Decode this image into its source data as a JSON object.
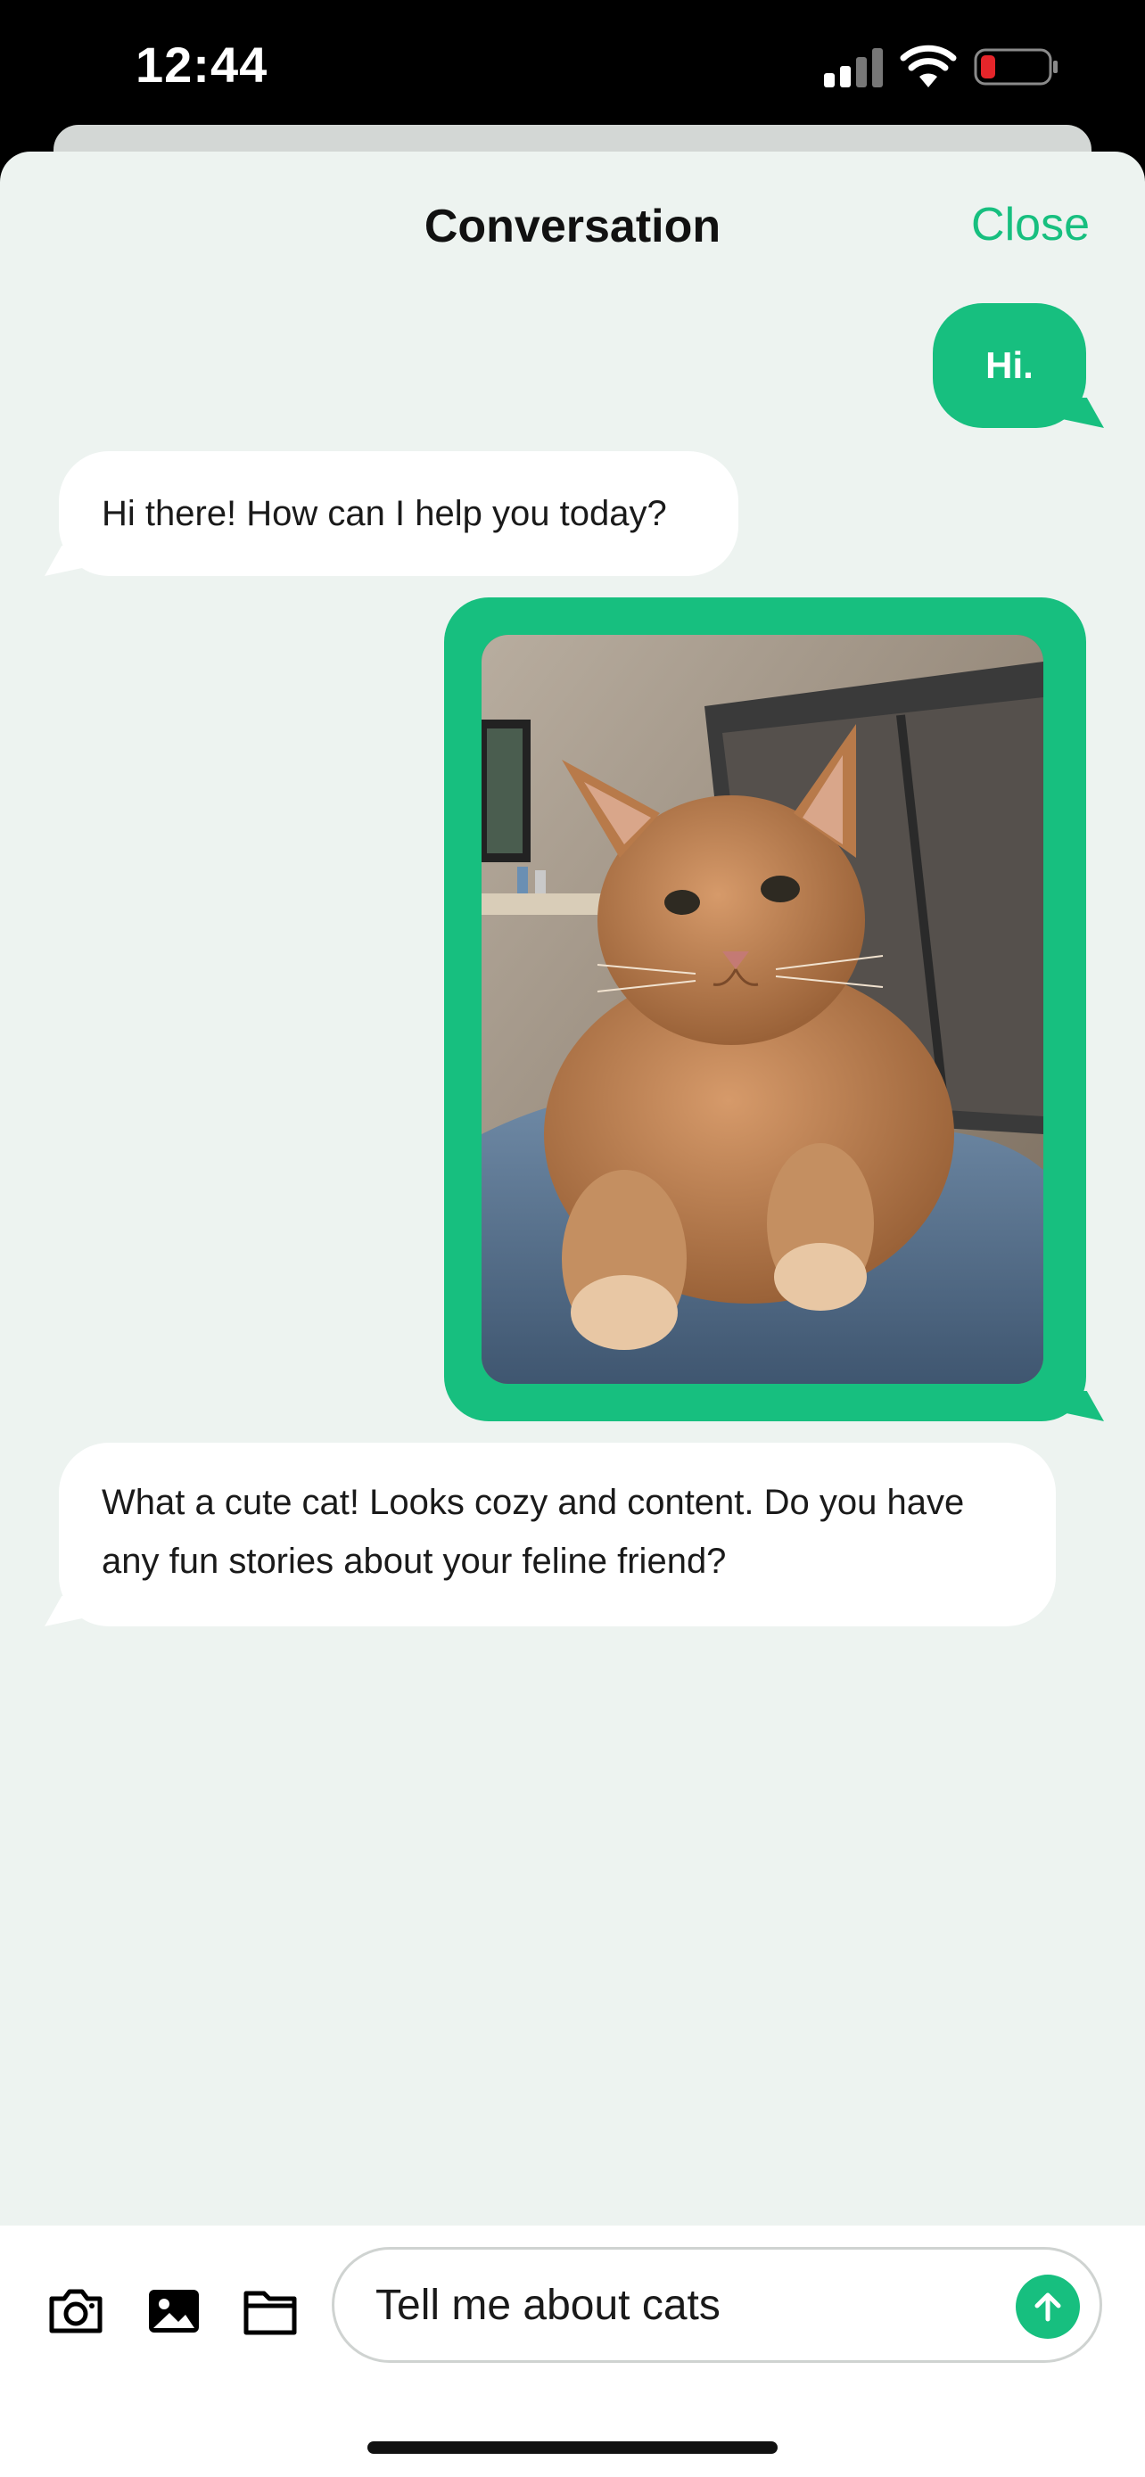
{
  "status_bar": {
    "time": "12:44",
    "icons": [
      "signal-icon",
      "wifi-icon",
      "battery-low-icon"
    ],
    "battery_color": "#e5252a"
  },
  "header": {
    "title": "Conversation",
    "close_label": "Close"
  },
  "messages": [
    {
      "role": "user",
      "type": "text",
      "text": "Hi."
    },
    {
      "role": "assistant",
      "type": "text",
      "text": "Hi there! How can I help you today?"
    },
    {
      "role": "user",
      "type": "image",
      "image": "cat-photo"
    },
    {
      "role": "assistant",
      "type": "text",
      "text": "What a cute cat! Looks cozy and content. Do you have any fun stories about your feline friend?"
    }
  ],
  "composer": {
    "tools": [
      "camera-icon",
      "image-icon",
      "folder-icon"
    ],
    "input_value": "Tell me about cats",
    "send_icon": "arrow-up-icon"
  },
  "colors": {
    "accent": "#17bf7f",
    "background": "#edf3f0",
    "bubble_assistant": "#ffffff"
  }
}
